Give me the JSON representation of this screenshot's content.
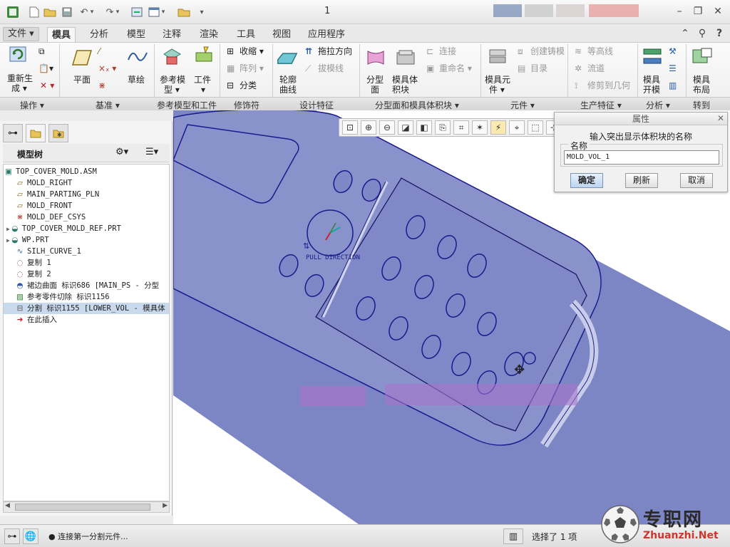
{
  "window": {
    "title": "1"
  },
  "menu_tabs": [
    {
      "label": "文件",
      "arrow": "▾"
    },
    {
      "label": "模具"
    },
    {
      "label": "分析"
    },
    {
      "label": "模型"
    },
    {
      "label": "注释"
    },
    {
      "label": "渲染"
    },
    {
      "label": "工具"
    },
    {
      "label": "视图"
    },
    {
      "label": "应用程序"
    }
  ],
  "ribbon": {
    "regenerate": "重新生",
    "regenerate2": "成 ▾",
    "plane": "平面",
    "sketch": "草绘",
    "ref_model": "参考模",
    "ref_model2": "型 ▾",
    "workpiece": "工件",
    "workpiece2": "▾",
    "shrink": "收缩 ▾",
    "array": "阵列 ▾",
    "classify": "分类",
    "contour": "轮廓",
    "contour2": "曲线",
    "drag_dir": "拖拉方向",
    "draft_line": "拔模线",
    "parting": "分型",
    "parting2": "面",
    "mold_vol": "模具体",
    "mold_vol2": "积块",
    "connect": "连接",
    "rename": "重命名 ▾",
    "mold_comp": "模具元",
    "mold_comp2": "件 ▾",
    "create_casting": "创建铸模",
    "catalog": "目录",
    "contour_lines": "等高线",
    "flow": "流道",
    "trim": "修剪到几何",
    "mold_open": "模具",
    "mold_open2": "开模",
    "mold_layout": "模具",
    "mold_layout2": "布局"
  },
  "groups": [
    {
      "label": "操作 ▾"
    },
    {
      "label": "基准 ▾"
    },
    {
      "label": "参考模型和工件"
    },
    {
      "label": "修饰符"
    },
    {
      "label": "设计特征"
    },
    {
      "label": "分型面和模具体积块 ▾"
    },
    {
      "label": "元件 ▾"
    },
    {
      "label": "生产特征 ▾"
    },
    {
      "label": "分析 ▾"
    },
    {
      "label": "转到"
    }
  ],
  "model_tree": {
    "header": "模型树",
    "items": [
      {
        "label": "TOP_COVER_MOLD.ASM",
        "icon": "assembly-icon"
      },
      {
        "label": "MOLD_RIGHT",
        "icon": "datum-plane-icon"
      },
      {
        "label": "MAIN_PARTING_PLN",
        "icon": "datum-plane-icon"
      },
      {
        "label": "MOLD_FRONT",
        "icon": "datum-plane-icon"
      },
      {
        "label": "MOLD_DEF_CSYS",
        "icon": "csys-icon"
      },
      {
        "label": "TOP_COVER_MOLD_REF.PRT",
        "icon": "part-icon"
      },
      {
        "label": "WP.PRT",
        "icon": "part-icon"
      },
      {
        "label": "SILH_CURVE_1",
        "icon": "curve-icon"
      },
      {
        "label": "复制 1",
        "icon": "copy-icon"
      },
      {
        "label": "复制 2",
        "icon": "copy-icon"
      },
      {
        "label": "裙边曲面 标识686 [MAIN_PS - 分型",
        "icon": "surface-icon"
      },
      {
        "label": "参考零件切除 标识1156",
        "icon": "cut-icon"
      },
      {
        "label": "分割 标识1155 [LOWER_VOL - 模具体",
        "icon": "split-icon"
      },
      {
        "label": "在此插入",
        "icon": "insert-arrow-icon"
      }
    ]
  },
  "viewport": {
    "annotation": "PULL DIRECTION"
  },
  "properties_dialog": {
    "title": "属性",
    "prompt": "输入突出显示体积块的名称",
    "field_label": "名称",
    "field_value": "MOLD_VOL_1",
    "ok": "确定",
    "refresh": "刷新",
    "cancel": "取消"
  },
  "status": {
    "message": "● 连接第一分割元件...",
    "selection": "选择了 1 项"
  },
  "watermark": {
    "cn": "专职网",
    "en": "Zhuanzhi.Net"
  },
  "colors": {
    "model_fill": "#7d86c4",
    "model_edge": "#1a1a8c",
    "selection_row": "#c9d9ee",
    "ok_button": "#bcd5ef"
  }
}
